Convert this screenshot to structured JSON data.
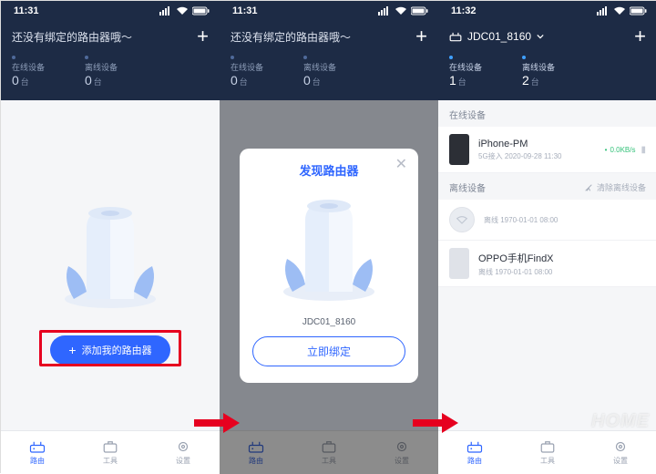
{
  "screens": {
    "s1": {
      "time": "11:31",
      "title": "还没有绑定的路由器哦～",
      "stats": {
        "online_label": "在线设备",
        "online_value": "0",
        "online_unit": "台",
        "offline_label": "离线设备",
        "offline_value": "0",
        "offline_unit": "台"
      },
      "add_button": "添加我的路由器"
    },
    "s2": {
      "time": "11:31",
      "title": "还没有绑定的路由器哦～",
      "stats": {
        "online_label": "在线设备",
        "online_value": "0",
        "online_unit": "台",
        "offline_label": "离线设备",
        "offline_value": "0",
        "offline_unit": "台"
      },
      "modal": {
        "title": "发现路由器",
        "device_name": "JDC01_8160",
        "bind_button": "立即绑定"
      }
    },
    "s3": {
      "time": "11:32",
      "router_name": "JDC01_8160",
      "stats": {
        "online_label": "在线设备",
        "online_value": "1",
        "online_unit": "台",
        "offline_label": "离线设备",
        "offline_value": "2",
        "offline_unit": "台"
      },
      "sections": {
        "online_title": "在线设备",
        "offline_title": "离线设备",
        "clear_offline": "清除离线设备"
      },
      "online_devices": [
        {
          "name": "iPhone-PM",
          "sub": "5G接入 2020-09-28 11:30",
          "rate": "0.0KB/s"
        }
      ],
      "offline_devices": [
        {
          "name": "",
          "sub": "离线 1970-01-01 08:00",
          "icon": "router"
        },
        {
          "name": "OPPO手机FindX",
          "sub": "离线 1970-01-01 08:00",
          "icon": "phone"
        }
      ]
    }
  },
  "tabs": {
    "router": "路由",
    "tools": "工具",
    "settings": "设置"
  },
  "watermark": "HOME"
}
